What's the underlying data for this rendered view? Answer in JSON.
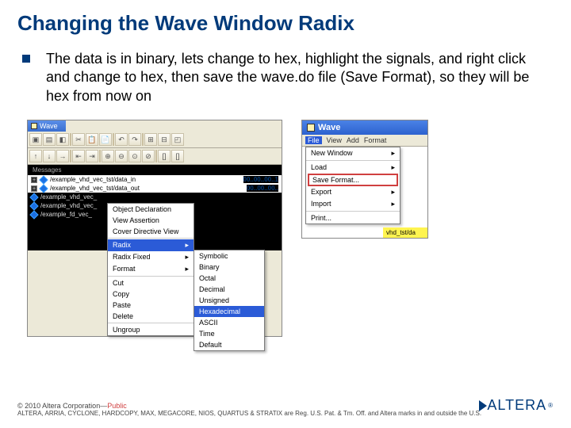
{
  "title": "Changing the Wave Window Radix",
  "body": "The data is in binary, lets change to hex, highlight the signals, and right click and change to hex, then save the wave.do file (Save Format), so they will be hex from now on",
  "shot1": {
    "tab": "Wave",
    "headers": "Messages",
    "signals": [
      {
        "name": "/example_vhd_vec_tst/data_in",
        "val": "00..00..00..1"
      },
      {
        "name": "/example_vhd_vec_tst/data_out",
        "val": "00..00..00.."
      },
      {
        "name": "/example_vhd_vec_",
        "val": ""
      },
      {
        "name": "/example_vhd_vec_",
        "val": ""
      },
      {
        "name": "/example_fd_vec_",
        "val": ""
      }
    ],
    "context": {
      "items_a": [
        "Object Declaration",
        "View Assertion",
        "Cover Directive View"
      ],
      "radix": "Radix",
      "items_b": [
        "Radix Fixed",
        "Format"
      ],
      "items_c": [
        "Cut",
        "Copy",
        "Paste",
        "Delete"
      ],
      "items_d": [
        "Ungroup"
      ]
    },
    "submenu": {
      "items_top": [
        "Symbolic",
        "Binary",
        "Octal",
        "Decimal",
        "Unsigned"
      ],
      "hex": "Hexadecimal",
      "items_bot": [
        "ASCII",
        "Time",
        "Default"
      ]
    }
  },
  "shot2": {
    "title": "Wave",
    "menu_open": "File",
    "menu_rest": [
      "View",
      "Add",
      "Format"
    ],
    "dropdown": {
      "top": [
        "New Window"
      ],
      "load": "Load",
      "save": "Save Format...",
      "rest": [
        "Export",
        "Import"
      ],
      "rest2": [
        "Print..."
      ]
    },
    "fragment": "vhd_tst/da"
  },
  "footer": {
    "line1a": "© 2010 Altera Corporation—",
    "line1b": "Public",
    "line2": "ALTERA, ARRIA, CYCLONE, HARDCOPY, MAX, MEGACORE, NIOS, QUARTUS & STRATIX are Reg. U.S. Pat. & Tm. Off. and Altera marks in and outside the U.S."
  },
  "logo": "ALTERA",
  "reg": "®"
}
